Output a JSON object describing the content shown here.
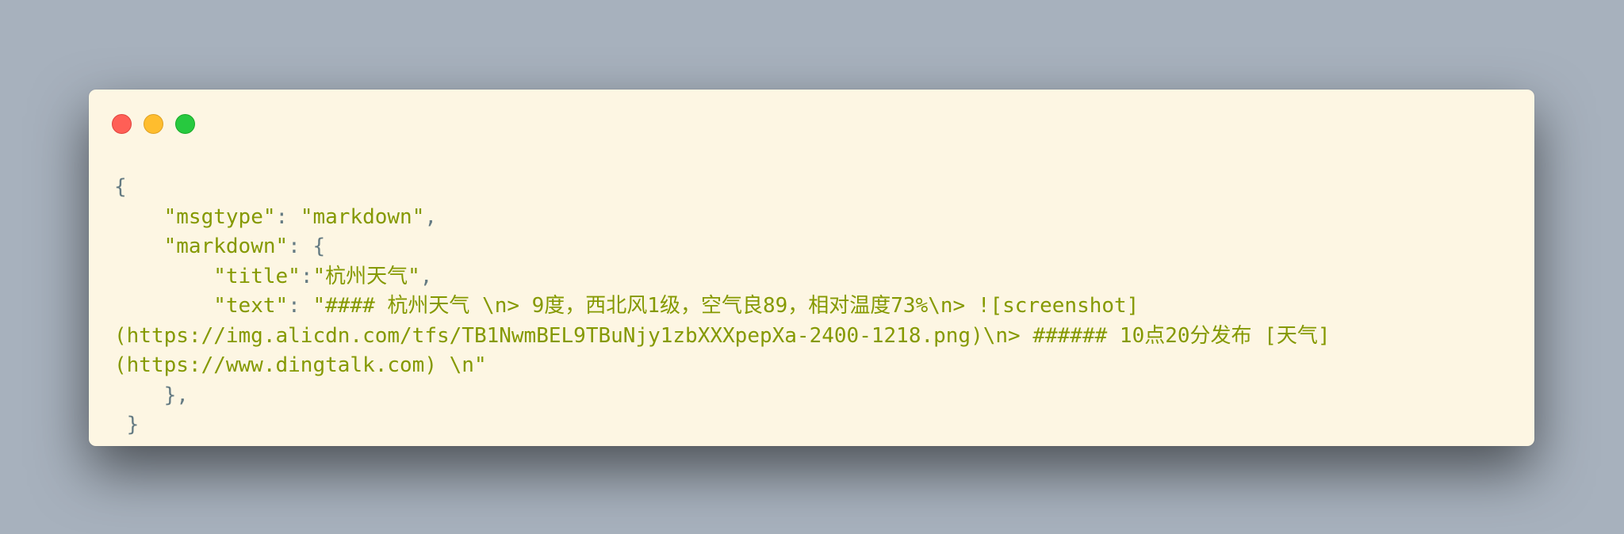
{
  "window": {
    "controls": [
      "close",
      "minimize",
      "zoom"
    ]
  },
  "code": {
    "lines": [
      [
        {
          "t": "{",
          "k": "p"
        }
      ],
      [
        {
          "t": "    ",
          "k": "p"
        },
        {
          "t": "\"msgtype\"",
          "k": "s"
        },
        {
          "t": ": ",
          "k": "p"
        },
        {
          "t": "\"markdown\"",
          "k": "s"
        },
        {
          "t": ",",
          "k": "p"
        }
      ],
      [
        {
          "t": "    ",
          "k": "p"
        },
        {
          "t": "\"markdown\"",
          "k": "s"
        },
        {
          "t": ": {",
          "k": "p"
        }
      ],
      [
        {
          "t": "        ",
          "k": "p"
        },
        {
          "t": "\"title\"",
          "k": "s"
        },
        {
          "t": ":",
          "k": "p"
        },
        {
          "t": "\"杭州天气\"",
          "k": "s"
        },
        {
          "t": ",",
          "k": "p"
        }
      ],
      [
        {
          "t": "        ",
          "k": "p"
        },
        {
          "t": "\"text\"",
          "k": "s"
        },
        {
          "t": ": ",
          "k": "p"
        },
        {
          "t": "\"#### 杭州天气 \\n> 9度，西北风1级，空气良89，相对温度73%\\n> ![screenshot]",
          "k": "s"
        }
      ],
      [
        {
          "t": "(https://img.alicdn.com/tfs/TB1NwmBEL9TBuNjy1zbXXXpepXa-2400-1218.png)\\n> ###### 10点20分发布 [天气]",
          "k": "s"
        }
      ],
      [
        {
          "t": "(https://www.dingtalk.com) \\n\"",
          "k": "s"
        }
      ],
      [
        {
          "t": "    },",
          "k": "p"
        }
      ],
      [
        {
          "t": " }",
          "k": "p"
        }
      ]
    ]
  }
}
